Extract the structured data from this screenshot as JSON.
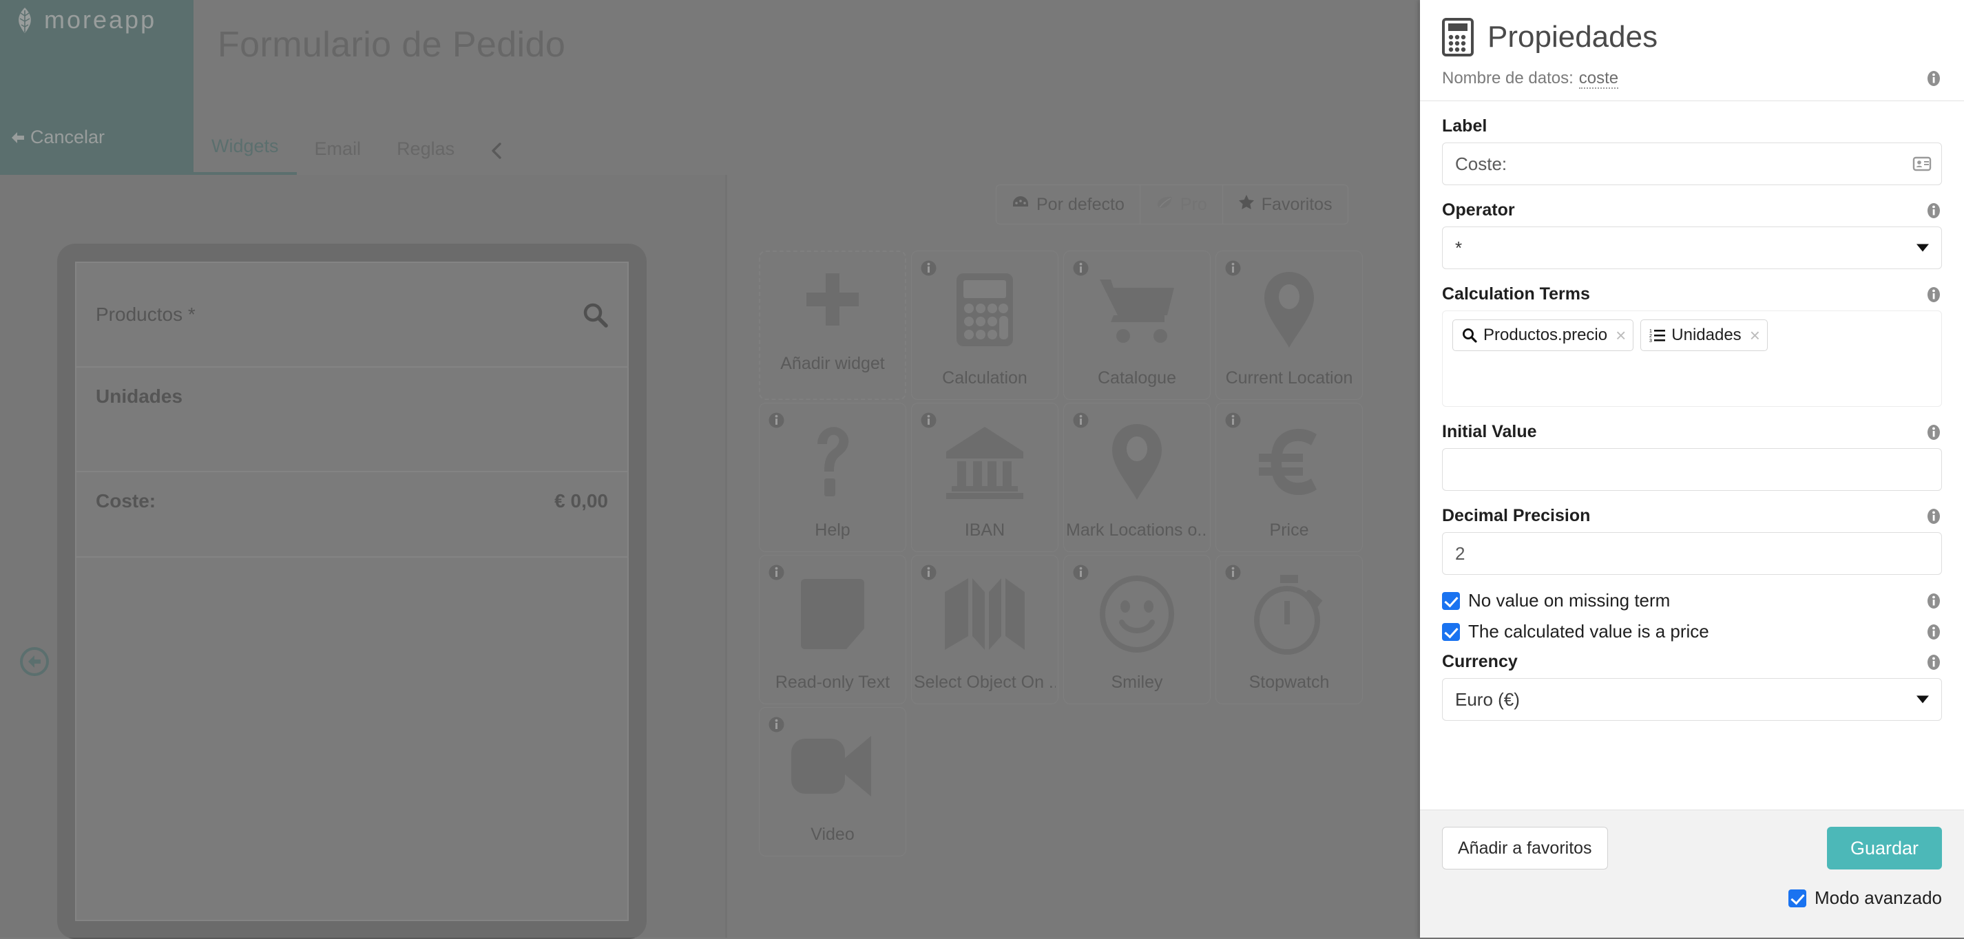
{
  "brand": {
    "name": "moreapp",
    "logo_icon": "leaf-icon",
    "cancel_label": "Cancelar",
    "cancel_icon": "arrow-left-icon"
  },
  "header": {
    "title": "Formulario de Pedido"
  },
  "tabs": [
    {
      "label": "Widgets",
      "active": true
    },
    {
      "label": "Email",
      "active": false
    },
    {
      "label": "Reglas",
      "active": false
    }
  ],
  "collapse_icon": "chevron-left-icon",
  "back_button_icon": "arrow-left-circle-icon",
  "preview": {
    "rows": [
      {
        "label": "Productos *",
        "value": "",
        "icon": "search-icon",
        "bold": false
      },
      {
        "label": "Unidades",
        "value": "",
        "icon": "",
        "bold": true
      },
      {
        "label": "Coste:",
        "value": "€ 0,00",
        "icon": "",
        "bold": true
      }
    ]
  },
  "palette": {
    "filters": [
      {
        "label": "Por defecto",
        "icon": "dashboard-icon",
        "muted": false
      },
      {
        "label": "Pro",
        "icon": "leaf-icon",
        "muted": true
      },
      {
        "label": "Favoritos",
        "icon": "star-icon",
        "muted": false
      }
    ],
    "widgets": [
      {
        "label": "Añadir widget",
        "icon": "plus-icon",
        "add": true,
        "info": false
      },
      {
        "label": "Calculation",
        "icon": "calculator-icon",
        "add": false,
        "info": true
      },
      {
        "label": "Catalogue",
        "icon": "shopping-cart-icon",
        "add": false,
        "info": true
      },
      {
        "label": "Current Location",
        "icon": "map-pin-icon",
        "add": false,
        "info": true
      },
      {
        "label": "Help",
        "icon": "question-mark-icon",
        "add": false,
        "info": true
      },
      {
        "label": "IBAN",
        "icon": "bank-icon",
        "add": false,
        "info": true
      },
      {
        "label": "Mark Locations o...",
        "icon": "map-pin-icon",
        "add": false,
        "info": true
      },
      {
        "label": "Price",
        "icon": "euro-icon",
        "add": false,
        "info": true
      },
      {
        "label": "Read-only Text",
        "icon": "document-icon",
        "add": false,
        "info": true
      },
      {
        "label": "Select Object On ...",
        "icon": "map-folded-icon",
        "add": false,
        "info": true
      },
      {
        "label": "Smiley",
        "icon": "smiley-icon",
        "add": false,
        "info": true
      },
      {
        "label": "Stopwatch",
        "icon": "stopwatch-icon",
        "add": false,
        "info": true
      },
      {
        "label": "Video",
        "icon": "video-camera-icon",
        "add": false,
        "info": true
      }
    ]
  },
  "properties": {
    "icon": "calculator-icon",
    "title": "Propiedades",
    "data_name_label": "Nombre de datos:",
    "data_name_value": "coste",
    "label_field": {
      "label": "Label",
      "value": "Coste:",
      "inner_icon": "contact-card-icon"
    },
    "operator_field": {
      "label": "Operator",
      "value": "*"
    },
    "calculation_terms": {
      "label": "Calculation Terms",
      "tags": [
        {
          "text": "Productos.precio",
          "icon": "search-icon",
          "close": "×"
        },
        {
          "text": "Unidades",
          "icon": "numbered-list-icon",
          "close": "×"
        }
      ]
    },
    "initial_value": {
      "label": "Initial Value",
      "value": ""
    },
    "decimal_precision": {
      "label": "Decimal Precision",
      "value": "2"
    },
    "checkboxes": [
      {
        "label": "No value on missing term",
        "checked": true
      },
      {
        "label": "The calculated value is a price",
        "checked": true
      }
    ],
    "currency": {
      "label": "Currency",
      "value": "Euro (€)"
    },
    "footer": {
      "favorites_label": "Añadir a favoritos",
      "save_label": "Guardar",
      "advanced_label": "Modo avanzado",
      "advanced_checked": true
    }
  },
  "colors": {
    "brand_teal": "#2e6260",
    "save_teal": "#4cb8b8",
    "checkbox_blue": "#1a73f0",
    "panel_white": "#ffffff",
    "dim_gray": "#7b7b7b"
  }
}
